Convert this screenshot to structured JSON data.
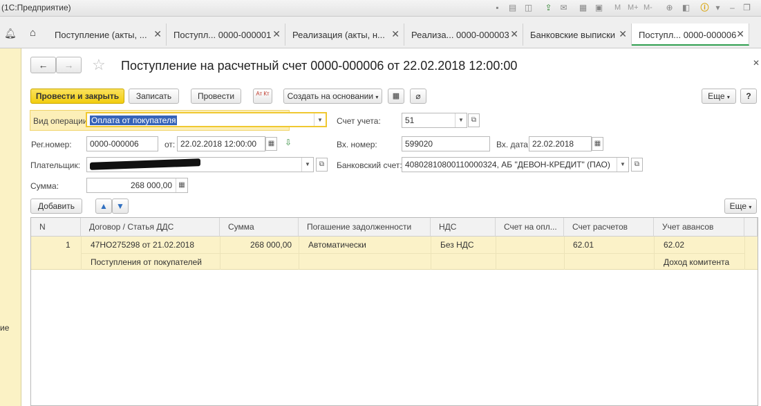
{
  "app": {
    "title": "(1С:Предприятие)"
  },
  "toolbar_text": {
    "m": "M",
    "m_plus": "M+",
    "m_minus": "M-"
  },
  "tabs": [
    {
      "label": "Поступление (акты, ..."
    },
    {
      "label": "Поступл... 0000-000001"
    },
    {
      "label": "Реализация (акты, н..."
    },
    {
      "label": "Реализа... 0000-000003"
    },
    {
      "label": "Банковские выписки"
    },
    {
      "label": "Поступл... 0000-000006"
    }
  ],
  "sidebar": {
    "label": "ие"
  },
  "document": {
    "title": "Поступление на расчетный счет 0000-000006 от 22.02.2018 12:00:00"
  },
  "commands": {
    "post_close": "Провести и закрыть",
    "write": "Записать",
    "post": "Провести",
    "dt_kt": "Ат Кт",
    "create_based": "Создать на основании",
    "more": "Еще",
    "help": "?"
  },
  "form": {
    "op_type_label": "Вид операции:",
    "op_type_value": "Оплата от покупателя",
    "account_label": "Счет учета:",
    "account_value": "51",
    "reg_label": "Рег.номер:",
    "reg_value": "0000-000006",
    "date_label": "от:",
    "date_value": "22.02.2018 12:00:00",
    "in_num_label": "Вх. номер:",
    "in_num_value": "599020",
    "in_date_label": "Вх. дата:",
    "in_date_value": "22.02.2018",
    "payer_label": "Плательщик:",
    "bank_acc_label": "Банковский счет:",
    "bank_acc_value": "40802810800110000324, АБ \"ДЕВОН-КРЕДИТ\" (ПАО)",
    "sum_label": "Сумма:",
    "sum_value": "268 000,00"
  },
  "table_toolbar": {
    "add": "Добавить",
    "more": "Еще"
  },
  "table": {
    "columns": [
      "N",
      "Договор / Статья ДДС",
      "Сумма",
      "Погашение задолженности",
      "НДС",
      "Счет на опл...",
      "Счет расчетов",
      "Учет авансов"
    ],
    "rows": [
      {
        "n": "1",
        "contract": "47НО275298 от 21.02.2018",
        "dds": "Поступления от покупателей",
        "sum": "268 000,00",
        "repayment": "Автоматически",
        "vat": "Без НДС",
        "invoice": "",
        "settlement": "62.01",
        "advance": "62.02",
        "advance_note": "Доход комитента"
      }
    ]
  }
}
